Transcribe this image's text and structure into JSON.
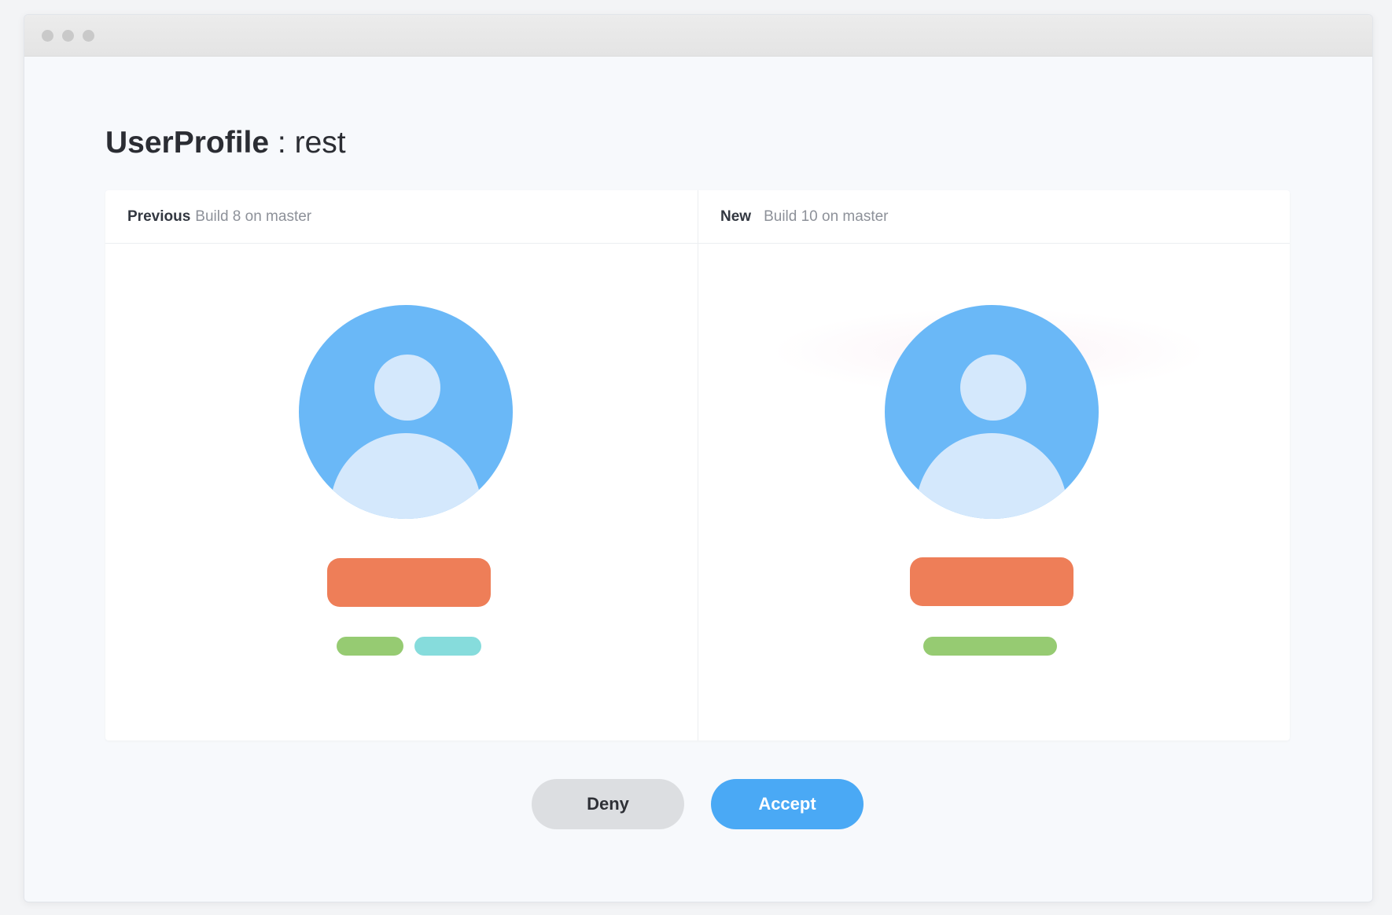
{
  "window": {
    "controls": [
      "close",
      "minimize",
      "maximize"
    ]
  },
  "heading": {
    "component": "UserProfile",
    "story": " : rest"
  },
  "previous": {
    "label": "Previous",
    "meta": "Build 8 on master"
  },
  "new": {
    "label": "New",
    "meta": "Build 10 on master"
  },
  "actions": {
    "deny_label": "Deny",
    "accept_label": "Accept"
  },
  "colors": {
    "avatar": "#6ab8f7",
    "avatar_figure": "#d4e8fc",
    "name_bar": "#ee7e58",
    "tag_green": "#96cb72",
    "tag_cyan": "#86dcdc",
    "accept": "#4aa9f5",
    "deny": "#dcdee1"
  }
}
